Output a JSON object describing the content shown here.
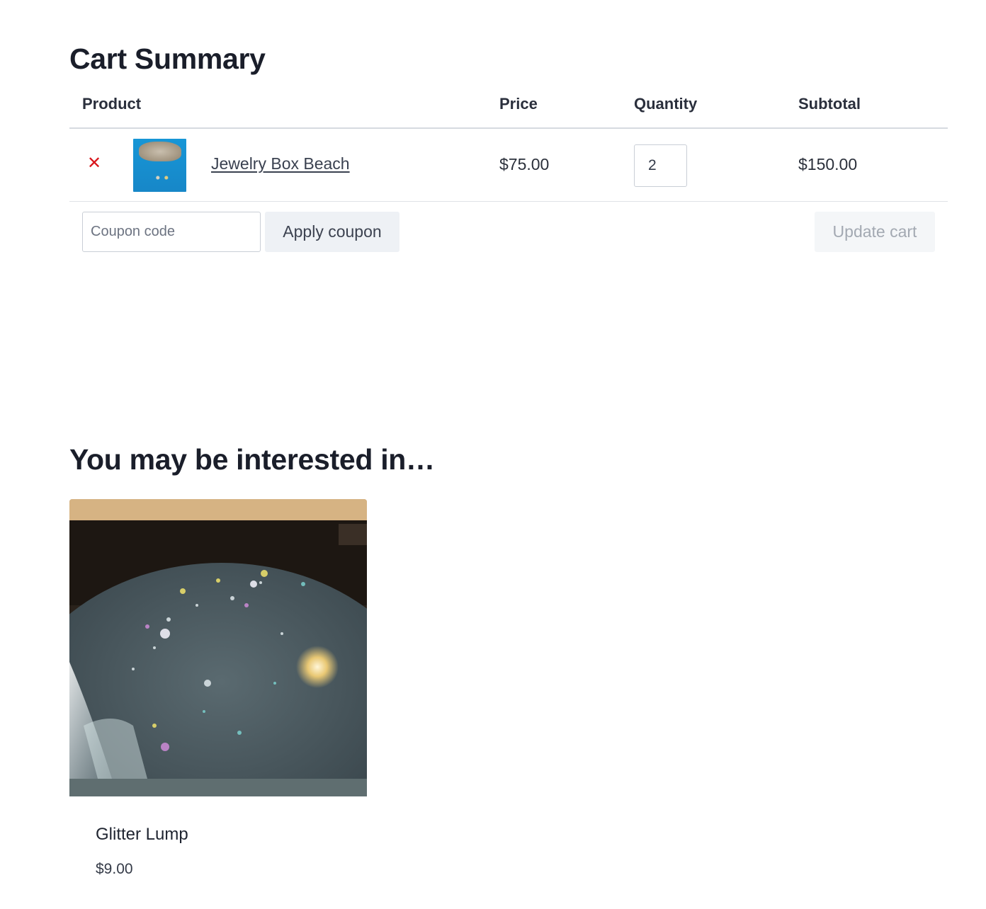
{
  "cart": {
    "title": "Cart Summary",
    "columns": {
      "product": "Product",
      "price": "Price",
      "quantity": "Quantity",
      "subtotal": "Subtotal"
    },
    "items": [
      {
        "remove_icon": "close-icon",
        "remove_glyph": "✕",
        "name": "Jewelry Box Beach",
        "price": "$75.00",
        "quantity": "2",
        "subtotal": "$150.00"
      }
    ],
    "coupon": {
      "placeholder": "Coupon code",
      "value": "",
      "apply_label": "Apply coupon"
    },
    "update_label": "Update cart",
    "colors": {
      "remove": "#d9161c",
      "disabled_text": "#a3a9b2"
    }
  },
  "related": {
    "title": "You may be interested in…",
    "products": [
      {
        "name": "Glitter Lump",
        "price": "$9.00"
      }
    ]
  }
}
